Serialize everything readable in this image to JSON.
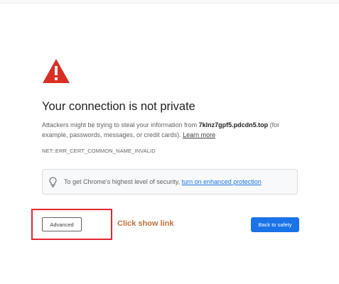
{
  "page": {
    "title": "Your connection is not private",
    "body_prefix": "Attackers might be trying to steal your information from ",
    "domain": "7klnz7gpf5.pdcdn5.top",
    "body_suffix": " (for example, passwords, messages, or credit cards). ",
    "learn_more": "Learn more",
    "error_code": "NET::ERR_CERT_COMMON_NAME_INVALID"
  },
  "tip": {
    "text": "To get Chrome's highest level of security, ",
    "link": "turn on enhanced protection",
    "icon": "lightbulb-icon"
  },
  "buttons": {
    "advanced": "Advanced",
    "back_to_safety": "Back to safety"
  },
  "annotation": {
    "text": "Click show link",
    "color": "#c0703a",
    "box_color": "#e3262f"
  },
  "colors": {
    "warning": "#d93025",
    "primary_button": "#1a73e8",
    "link": "#1a73e8"
  },
  "icons": {
    "warning": "warning-triangle-icon"
  }
}
